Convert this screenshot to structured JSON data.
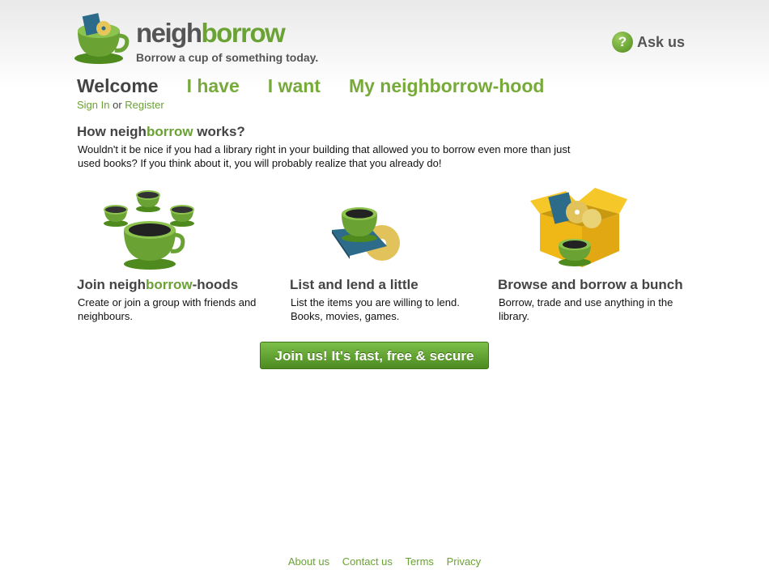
{
  "header": {
    "logo_text_part1": "neigh",
    "logo_text_part2": "borrow",
    "tagline": "Borrow a cup of something today.",
    "ask_label": "Ask us",
    "ask_icon_glyph": "?"
  },
  "nav": {
    "items": [
      {
        "label": "Welcome",
        "active": true
      },
      {
        "label": "I have",
        "active": false
      },
      {
        "label": "I want",
        "active": false
      },
      {
        "label": "My neighborrow-hood",
        "active": false
      }
    ]
  },
  "auth": {
    "sign_in": "Sign In",
    "or": "or",
    "register": "Register"
  },
  "how": {
    "title_part1": "How neigh",
    "title_part2": "borrow",
    "title_part3": " works?",
    "body": "Wouldn't it be nice if you had a library right in your building that allowed you to borrow even more than just used books? If you think about it, you will probably realize that you already do!"
  },
  "features": [
    {
      "icon": "cups-group-icon",
      "title_part1": "Join neigh",
      "title_part2": "borrow",
      "title_part3": "-hoods",
      "desc": "Create or join a group with friends and neighbours."
    },
    {
      "icon": "cup-books-discs-icon",
      "title": "List and lend a little",
      "desc": "List the items you are willing to lend. Books, movies, games."
    },
    {
      "icon": "box-of-items-icon",
      "title": "Browse and borrow a bunch",
      "desc": "Borrow, trade and use anything in the library."
    }
  ],
  "cta": {
    "label": "Join us! It's fast, free & secure"
  },
  "footer": {
    "links": [
      "About us",
      "Contact us",
      "Terms",
      "Privacy"
    ]
  },
  "colors": {
    "brand_green": "#6aa234",
    "text_gray": "#444444",
    "cta_top": "#7cbf48",
    "cta_bottom": "#4d8a22"
  }
}
